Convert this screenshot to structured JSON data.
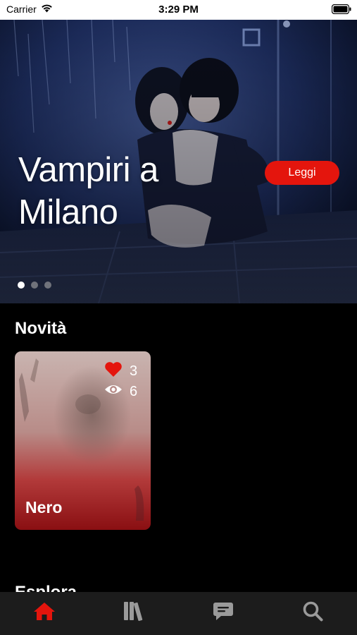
{
  "status_bar": {
    "carrier": "Carrier",
    "time": "3:29 PM"
  },
  "hero": {
    "title": "Vampiri a Milano",
    "read_button": "Leggi",
    "slides_count": 3,
    "active_slide": 1
  },
  "sections": {
    "novita": "Novità",
    "esplora": "Esplora"
  },
  "novita_items": [
    {
      "title": "Nero",
      "likes": "3",
      "views": "6"
    }
  ],
  "tab_bar": {
    "active_color": "#e4150d",
    "inactive_color": "#9a9a9a",
    "tabs": [
      {
        "icon": "home-icon",
        "active": true
      },
      {
        "icon": "library-icon",
        "active": false
      },
      {
        "icon": "chat-icon",
        "active": false
      },
      {
        "icon": "search-icon",
        "active": false
      }
    ]
  },
  "colors": {
    "accent": "#e4150d",
    "background": "#000000"
  }
}
